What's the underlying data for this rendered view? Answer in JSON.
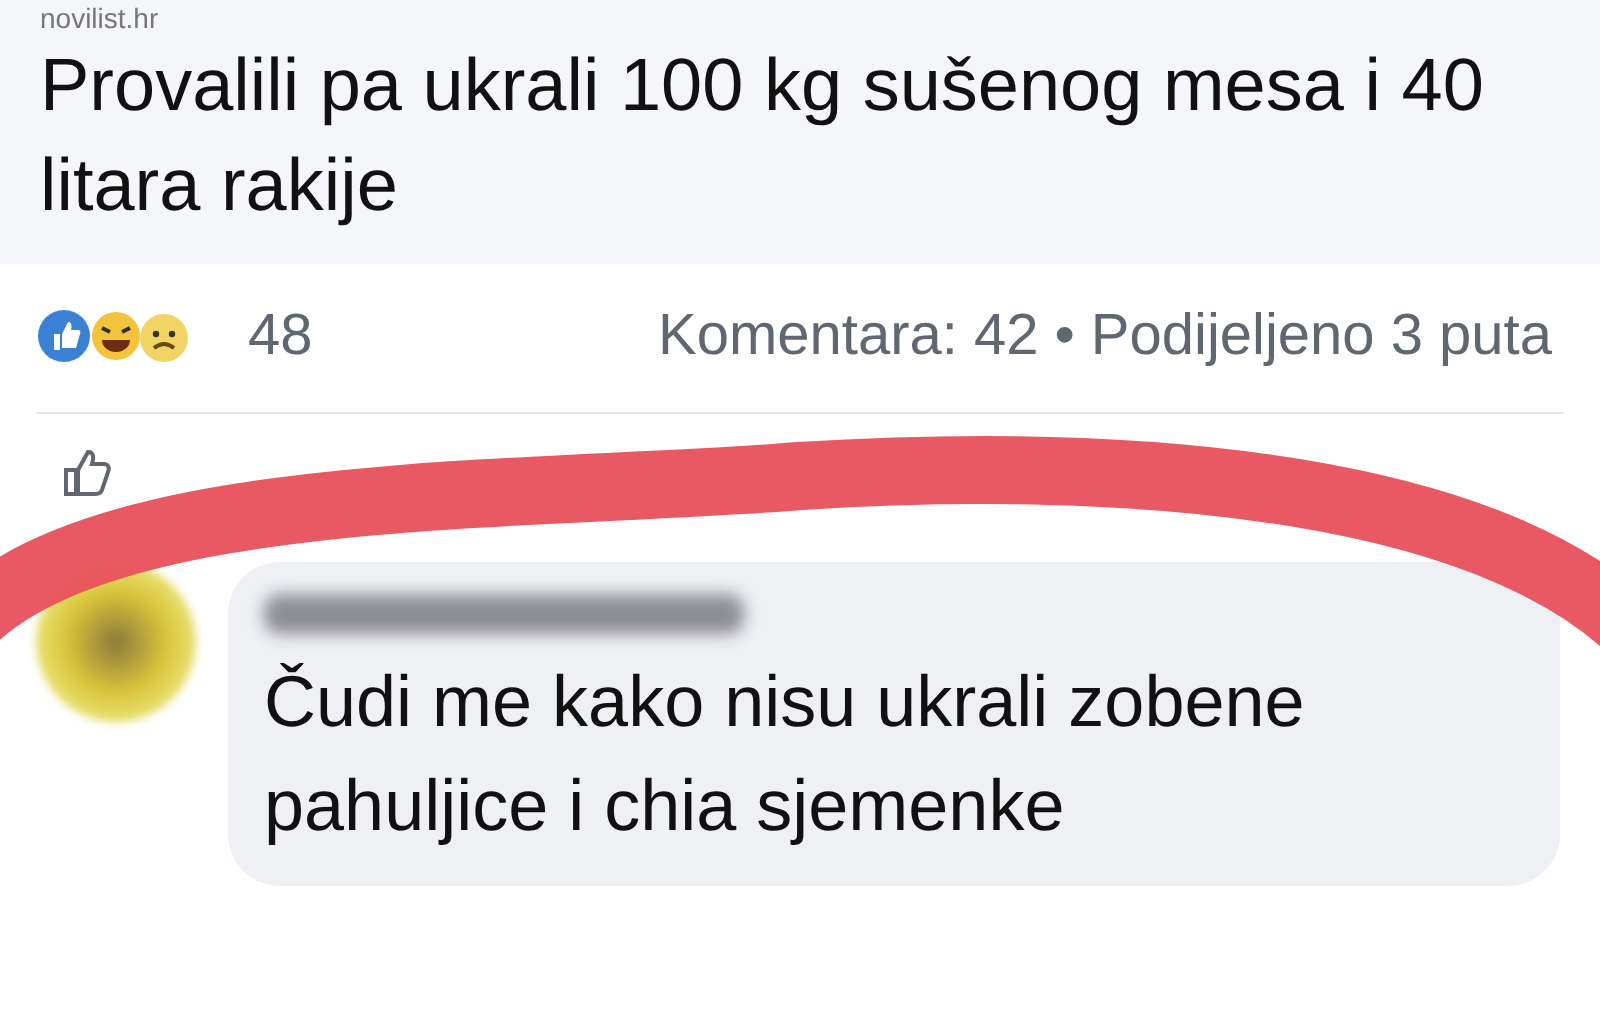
{
  "post": {
    "source": "novilist.hr",
    "title": "Provalili pa ukrali 100 kg sušenog mesa i 40 litara rakije"
  },
  "stats": {
    "reaction_count": "48",
    "comments": "Komentara: 42",
    "separator": "•",
    "shares": "Podijeljeno 3 puta"
  },
  "comment": {
    "text": "Čudi me kako nisu ukrali zobene pahuljice i chia sjemenke"
  }
}
